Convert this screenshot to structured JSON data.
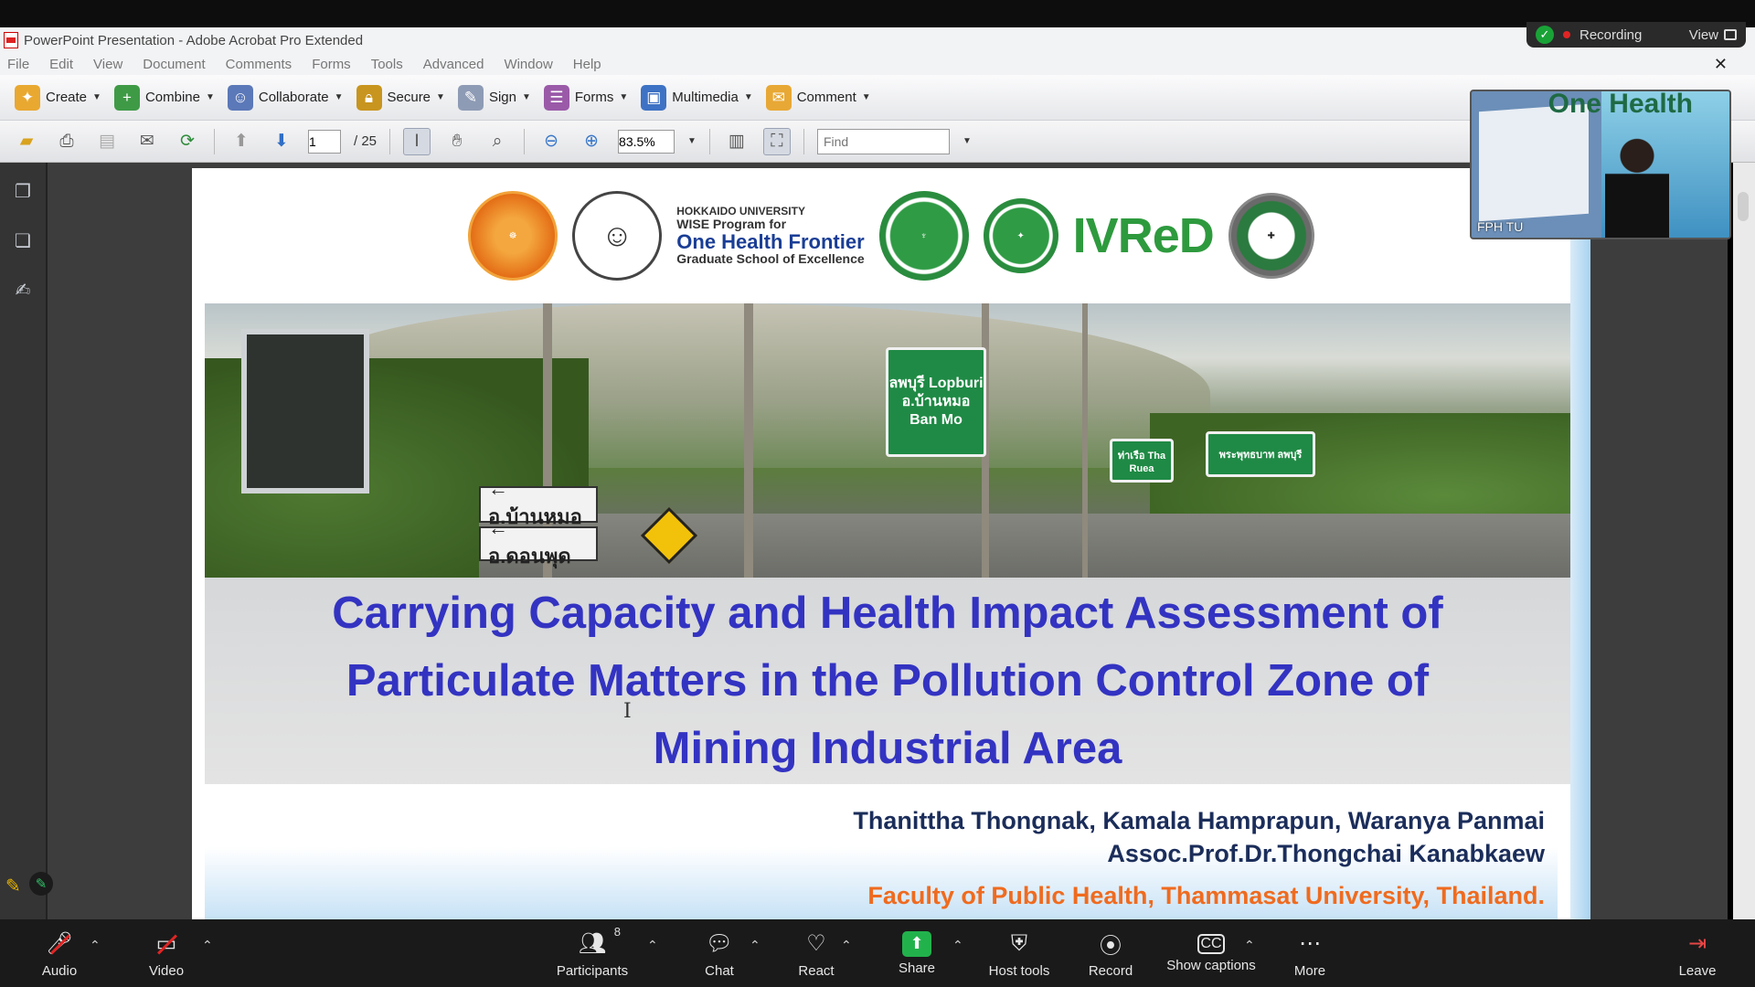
{
  "window": {
    "title": "PowerPoint Presentation - Adobe Acrobat Pro Extended"
  },
  "recording": {
    "label": "Recording",
    "view_label": "View"
  },
  "menu": [
    "File",
    "Edit",
    "View",
    "Document",
    "Comments",
    "Forms",
    "Tools",
    "Advanced",
    "Window",
    "Help"
  ],
  "toolbar": {
    "create": "Create",
    "combine": "Combine",
    "collaborate": "Collaborate",
    "secure": "Secure",
    "sign": "Sign",
    "forms": "Forms",
    "multimedia": "Multimedia",
    "comment": "Comment"
  },
  "nav": {
    "current_page": "1",
    "total_pages": "/ 25",
    "zoom": "83.5%",
    "find_placeholder": "Find"
  },
  "slide": {
    "logo_text": {
      "line1": "HOKKAIDO UNIVERSITY",
      "line2": "WISE Program for",
      "line3": "One Health Frontier",
      "line4": "Graduate School of Excellence"
    },
    "ivred": "IVReD",
    "signs": {
      "main": "ลพบุรี Lopburi อ.บ้านหมอ Ban Mo",
      "right1": "ท่าเรือ Tha Ruea",
      "right2": "พระพุทธบาท ลพบุรี",
      "thai1": "← อ.บ้านหมอ",
      "thai2": "← อ.ดอนพุด"
    },
    "title": "Carrying Capacity and Health Impact Assessment of Particulate Matters in the Pollution Control Zone of Mining Industrial Area",
    "authors_line1": "Thanittha Thongnak, Kamala Hamprapun, Waranya Panmai",
    "authors_line2": "Assoc.Prof.Dr.Thongchai Kanabkaew",
    "faculty": "Faculty of Public Health, Thammasat University, Thailand."
  },
  "video_thumb": {
    "name": "FPH TU",
    "banner": "One Health"
  },
  "controls": {
    "audio": "Audio",
    "video": "Video",
    "participants": "Participants",
    "participants_count": "8",
    "chat": "Chat",
    "react": "React",
    "share": "Share",
    "host_tools": "Host tools",
    "record": "Record",
    "captions": "Show captions",
    "more": "More",
    "leave": "Leave"
  }
}
